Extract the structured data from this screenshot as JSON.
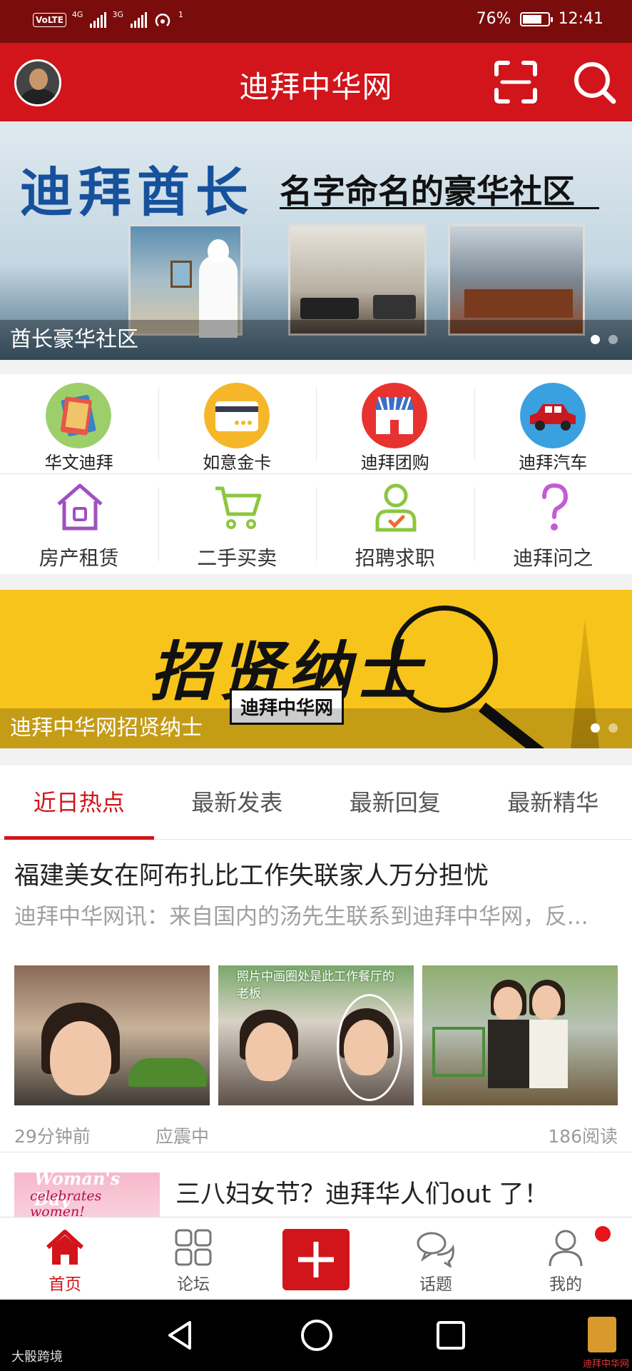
{
  "status_bar": {
    "volte": "VoLTE",
    "sim1": "4G",
    "sim2": "3G",
    "hotspot_count": "1",
    "battery": "76%",
    "time": "12:41"
  },
  "header": {
    "title": "迪拜中华网",
    "icons": [
      "avatar",
      "scan-icon",
      "search-icon"
    ]
  },
  "banner1": {
    "headline": "迪拜酋长",
    "subheadline": "名字命名的豪华社区",
    "caption": "酋长豪华社区",
    "slides": 2,
    "active_slide": 1
  },
  "quick_links_row1": [
    {
      "label": "华文迪拜",
      "icon": "book-icon",
      "color": "#9ccf6a"
    },
    {
      "label": "如意金卡",
      "icon": "card-icon",
      "color": "#f5b62a"
    },
    {
      "label": "迪拜团购",
      "icon": "shop-icon",
      "color": "#e8322f"
    },
    {
      "label": "迪拜汽车",
      "icon": "car-icon",
      "color": "#3aa0e0"
    }
  ],
  "quick_links_row2": [
    {
      "label": "房产租赁",
      "icon": "house-icon",
      "color": "#a04fc0"
    },
    {
      "label": "二手买卖",
      "icon": "cart-icon",
      "color": "#8cc63f"
    },
    {
      "label": "招聘求职",
      "icon": "person-check-icon",
      "color": "#8cc63f"
    },
    {
      "label": "迪拜问之",
      "icon": "question-icon",
      "color": "#c25cd6"
    }
  ],
  "banner2": {
    "headline": "招贤纳士",
    "stamp": "迪拜中华网",
    "caption": "迪拜中华网招贤纳士",
    "slides": 2,
    "active_slide": 1
  },
  "tabs": [
    {
      "label": "近日热点",
      "active": true
    },
    {
      "label": "最新发表",
      "active": false
    },
    {
      "label": "最新回复",
      "active": false
    },
    {
      "label": "最新精华",
      "active": false
    }
  ],
  "feed": {
    "post1": {
      "title": "福建美女在阿布扎比工作失联家人万分担忧",
      "excerpt": "迪拜中华网讯：来自国内的汤先生联系到迪拜中华网，反...",
      "image_note": "照片中画圈处是此工作餐厅的老板",
      "time": "29分钟前",
      "author": "应震中",
      "reads": "186阅读"
    },
    "post2": {
      "thumb_title": "Woman's Day",
      "thumb_subtitle": "celebrates women!",
      "title": "三八妇女节？迪拜华人们out 了！"
    }
  },
  "bottom_nav": {
    "home": "首页",
    "forum": "论坛",
    "topic": "话题",
    "me": "我的",
    "accent": "#d2141b"
  },
  "watermark": {
    "left": "大骰跨境",
    "right": "迪拜中华网"
  }
}
